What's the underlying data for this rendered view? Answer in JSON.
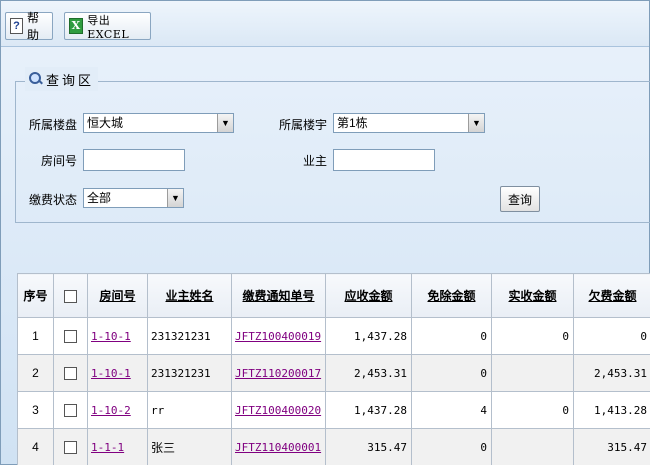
{
  "toolbar": {
    "help_label": "帮助",
    "help_icon": "help-icon",
    "export_label": "导出EXCEL",
    "export_icon": "excel-icon"
  },
  "query": {
    "legend": "查询区",
    "legend_icon": "magnifier-icon",
    "building_label": "所属楼盘",
    "building_value": "恒大城",
    "tower_label": "所属楼宇",
    "tower_value": "第1栋",
    "room_label": "房间号",
    "room_value": "",
    "owner_label": "业主",
    "owner_value": "",
    "status_label": "缴费状态",
    "status_value": "全部",
    "search_label": "查询"
  },
  "table": {
    "headers": {
      "no": "序号",
      "room": "房间号",
      "owner": "业主姓名",
      "notice": "缴费通知单号",
      "due": "应收金额",
      "waived": "免除金额",
      "received": "实收金额",
      "owed": "欠费金额"
    },
    "rows": [
      {
        "no": "1",
        "room": "1-10-1",
        "owner": "231321231",
        "notice": "JFTZ100400019",
        "due": "1,437.28",
        "waived": "0",
        "received": "0",
        "owed": "0"
      },
      {
        "no": "2",
        "room": "1-10-1",
        "owner": "231321231",
        "notice": "JFTZ110200017",
        "due": "2,453.31",
        "waived": "0",
        "received": "",
        "owed": "2,453.31"
      },
      {
        "no": "3",
        "room": "1-10-2",
        "owner": "rr",
        "notice": "JFTZ100400020",
        "due": "1,437.28",
        "waived": "4",
        "received": "0",
        "owed": "1,413.28"
      },
      {
        "no": "4",
        "room": "1-1-1",
        "owner": "张三",
        "notice": "JFTZ110400001",
        "due": "315.47",
        "waived": "0",
        "received": "",
        "owed": "315.47"
      }
    ]
  },
  "colors": {
    "link": "#800080",
    "background": "#dbe8f6",
    "alt_row": "#f1f1f1"
  }
}
